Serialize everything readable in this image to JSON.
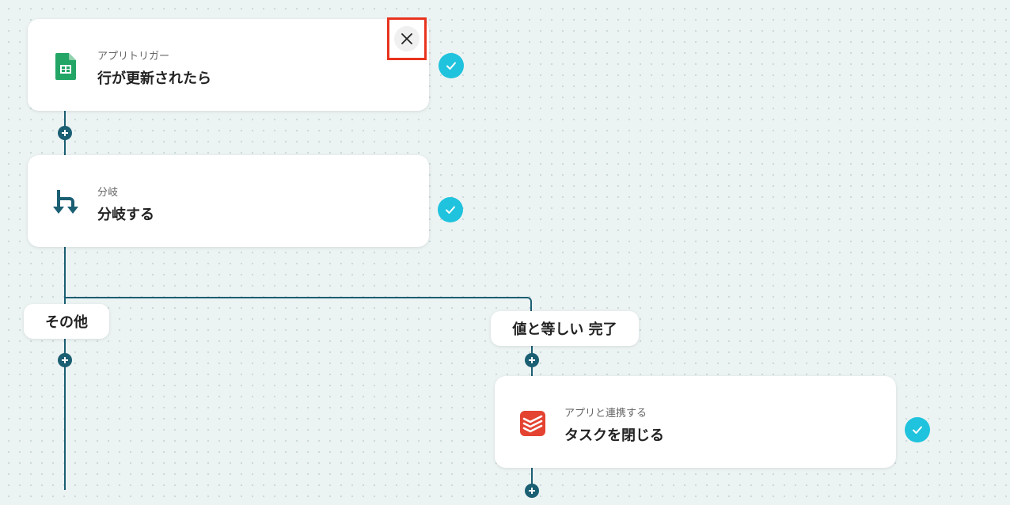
{
  "cards": {
    "trigger": {
      "sub": "アプリトリガー",
      "title": "行が更新されたら",
      "icon": "google-sheets-icon"
    },
    "branch": {
      "sub": "分岐",
      "title": "分岐する",
      "icon": "branch-icon"
    },
    "action": {
      "sub": "アプリと連携する",
      "title": "タスクを閉じる",
      "icon": "todoist-icon"
    }
  },
  "branches": {
    "other_label": "その他",
    "match_label": "値と等しい 完了"
  },
  "colors": {
    "line": "#1b5f73",
    "check": "#1fc3dd",
    "highlight": "#e8331e",
    "sheets_green": "#23a566",
    "todoist_red": "#e44332"
  }
}
